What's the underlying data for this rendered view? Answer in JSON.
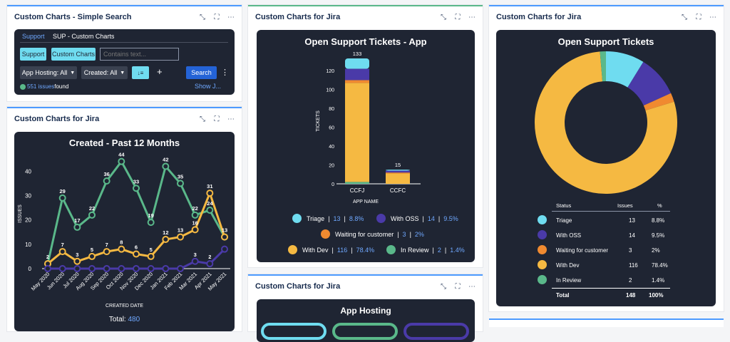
{
  "search_gadget": {
    "title": "Custom Charts - Simple Search",
    "tab_active": "Support",
    "tab_other": "SUP - Custom Charts",
    "chip_support": "Support",
    "chip_custom": "Custom Charts",
    "search_placeholder": "Contains text...",
    "filter_hosting": "App Hosting: All",
    "filter_created": "Created: All",
    "plus": "+",
    "search_btn": "Search",
    "more": "⋮",
    "issues_link": "551 issues",
    "issues_suffix": " found",
    "show_link": "Show J..."
  },
  "line_gadget": {
    "title": "Custom Charts for Jira",
    "footer_label": "Total:",
    "footer_value": "480",
    "chart_data": {
      "type": "line",
      "title": "Created - Past 12 Months",
      "xlabel": "CREATED DATE",
      "ylabel": "ISSUES",
      "ylim": [
        0,
        48
      ],
      "yticks": [
        0,
        10,
        20,
        30,
        40
      ],
      "categories": [
        "May 2020",
        "Jun 2020",
        "Jul 2020",
        "Aug 2020",
        "Sep 2020",
        "Oct 2020",
        "Nov 2020",
        "Dec 2020",
        "Jan 2021",
        "Feb 2021",
        "Mar 2021",
        "Apr 2021",
        "May 2021"
      ],
      "series": [
        {
          "color": "#5ab88a",
          "values": [
            2,
            29,
            17,
            22,
            36,
            44,
            33,
            19,
            42,
            35,
            22,
            24,
            13
          ]
        },
        {
          "color": "#f5b942",
          "values": [
            2,
            7,
            3,
            5,
            7,
            8,
            6,
            5,
            12,
            13,
            16,
            31,
            13
          ]
        },
        {
          "color": "#4a3aa8",
          "values": [
            0,
            0,
            0,
            0,
            0,
            0,
            0,
            0,
            0,
            0,
            3,
            2,
            8
          ]
        }
      ],
      "labeled": [
        {
          "series": 0,
          "values": [
            "2",
            "29",
            "17",
            "22",
            "36",
            "44",
            "33",
            "19",
            "42",
            "35",
            "22",
            "24",
            "13"
          ]
        },
        {
          "series": 1,
          "values": [
            "",
            "7",
            "3",
            "5",
            "7",
            "8",
            "6",
            "5",
            "12",
            "13",
            "16",
            "31",
            ""
          ]
        },
        {
          "series": 2,
          "values": [
            "",
            "",
            "",
            "",
            "",
            "",
            "",
            "",
            "",
            "",
            "3",
            "2",
            ""
          ]
        }
      ]
    }
  },
  "bar_gadget": {
    "title": "Custom Charts for Jira",
    "chart_data": {
      "type": "bar",
      "title": "Open Support Tickets - App",
      "xlabel": "APP NAME",
      "ylabel": "TICKETS",
      "ylim": [
        0,
        133
      ],
      "yticks": [
        0,
        20,
        40,
        60,
        80,
        100,
        120
      ],
      "categories": [
        "CCFJ",
        "CCFC"
      ],
      "totals": [
        "133",
        "15"
      ],
      "stacks": [
        [
          {
            "name": "In Review",
            "color": "#5ab88a",
            "value": 2
          },
          {
            "name": "With Dev",
            "color": "#f5b942",
            "value": 105
          },
          {
            "name": "Waiting for customer",
            "color": "#f08a30",
            "value": 3
          },
          {
            "name": "With OSS",
            "color": "#4a3aa8",
            "value": 12
          },
          {
            "name": "Triage",
            "color": "#6fdcf0",
            "value": 11
          }
        ],
        [
          {
            "name": "In Review",
            "color": "#5ab88a",
            "value": 0
          },
          {
            "name": "With Dev",
            "color": "#f5b942",
            "value": 11
          },
          {
            "name": "Waiting for customer",
            "color": "#f08a30",
            "value": 1
          },
          {
            "name": "With OSS",
            "color": "#4a3aa8",
            "value": 2
          },
          {
            "name": "Triage",
            "color": "#6fdcf0",
            "value": 1
          }
        ]
      ]
    },
    "legend": [
      {
        "label": "Triage",
        "count": "13",
        "pct": "8.8%",
        "color": "#6fdcf0"
      },
      {
        "label": "With OSS",
        "count": "14",
        "pct": "9.5%",
        "color": "#4a3aa8"
      },
      {
        "label": "Waiting for customer",
        "count": "3",
        "pct": "2%",
        "color": "#f08a30"
      },
      {
        "label": "With Dev",
        "count": "116",
        "pct": "78.4%",
        "color": "#f5b942"
      },
      {
        "label": "In Review",
        "count": "2",
        "pct": "1.4%",
        "color": "#5ab88a"
      }
    ]
  },
  "hosting_gadget": {
    "title": "Custom Charts for Jira",
    "chart_title": "App Hosting"
  },
  "donut_gadget": {
    "title": "Custom Charts for Jira",
    "chart_data": {
      "type": "pie",
      "title": "Open Support Tickets",
      "slices": [
        {
          "name": "Triage",
          "value": 13,
          "color": "#6fdcf0"
        },
        {
          "name": "With OSS",
          "value": 14,
          "color": "#4a3aa8"
        },
        {
          "name": "Waiting for customer",
          "value": 3,
          "color": "#f08a30"
        },
        {
          "name": "With Dev",
          "value": 116,
          "color": "#f5b942"
        },
        {
          "name": "In Review",
          "value": 2,
          "color": "#5ab88a"
        }
      ]
    },
    "table": {
      "headers": [
        "Status",
        "Issues",
        "%"
      ],
      "rows": [
        {
          "label": "Triage",
          "issues": "13",
          "pct": "8.8%",
          "color": "#6fdcf0"
        },
        {
          "label": "With OSS",
          "issues": "14",
          "pct": "9.5%",
          "color": "#4a3aa8"
        },
        {
          "label": "Waiting for customer",
          "issues": "3",
          "pct": "2%",
          "color": "#f08a30"
        },
        {
          "label": "With Dev",
          "issues": "116",
          "pct": "78.4%",
          "color": "#f5b942"
        },
        {
          "label": "In Review",
          "issues": "2",
          "pct": "1.4%",
          "color": "#5ab88a"
        }
      ],
      "total_label": "Total",
      "total_issues": "148",
      "total_pct": "100%"
    }
  },
  "icons": {
    "minimize": "minimize-icon",
    "expand": "expand-icon",
    "more": "more-icon"
  }
}
